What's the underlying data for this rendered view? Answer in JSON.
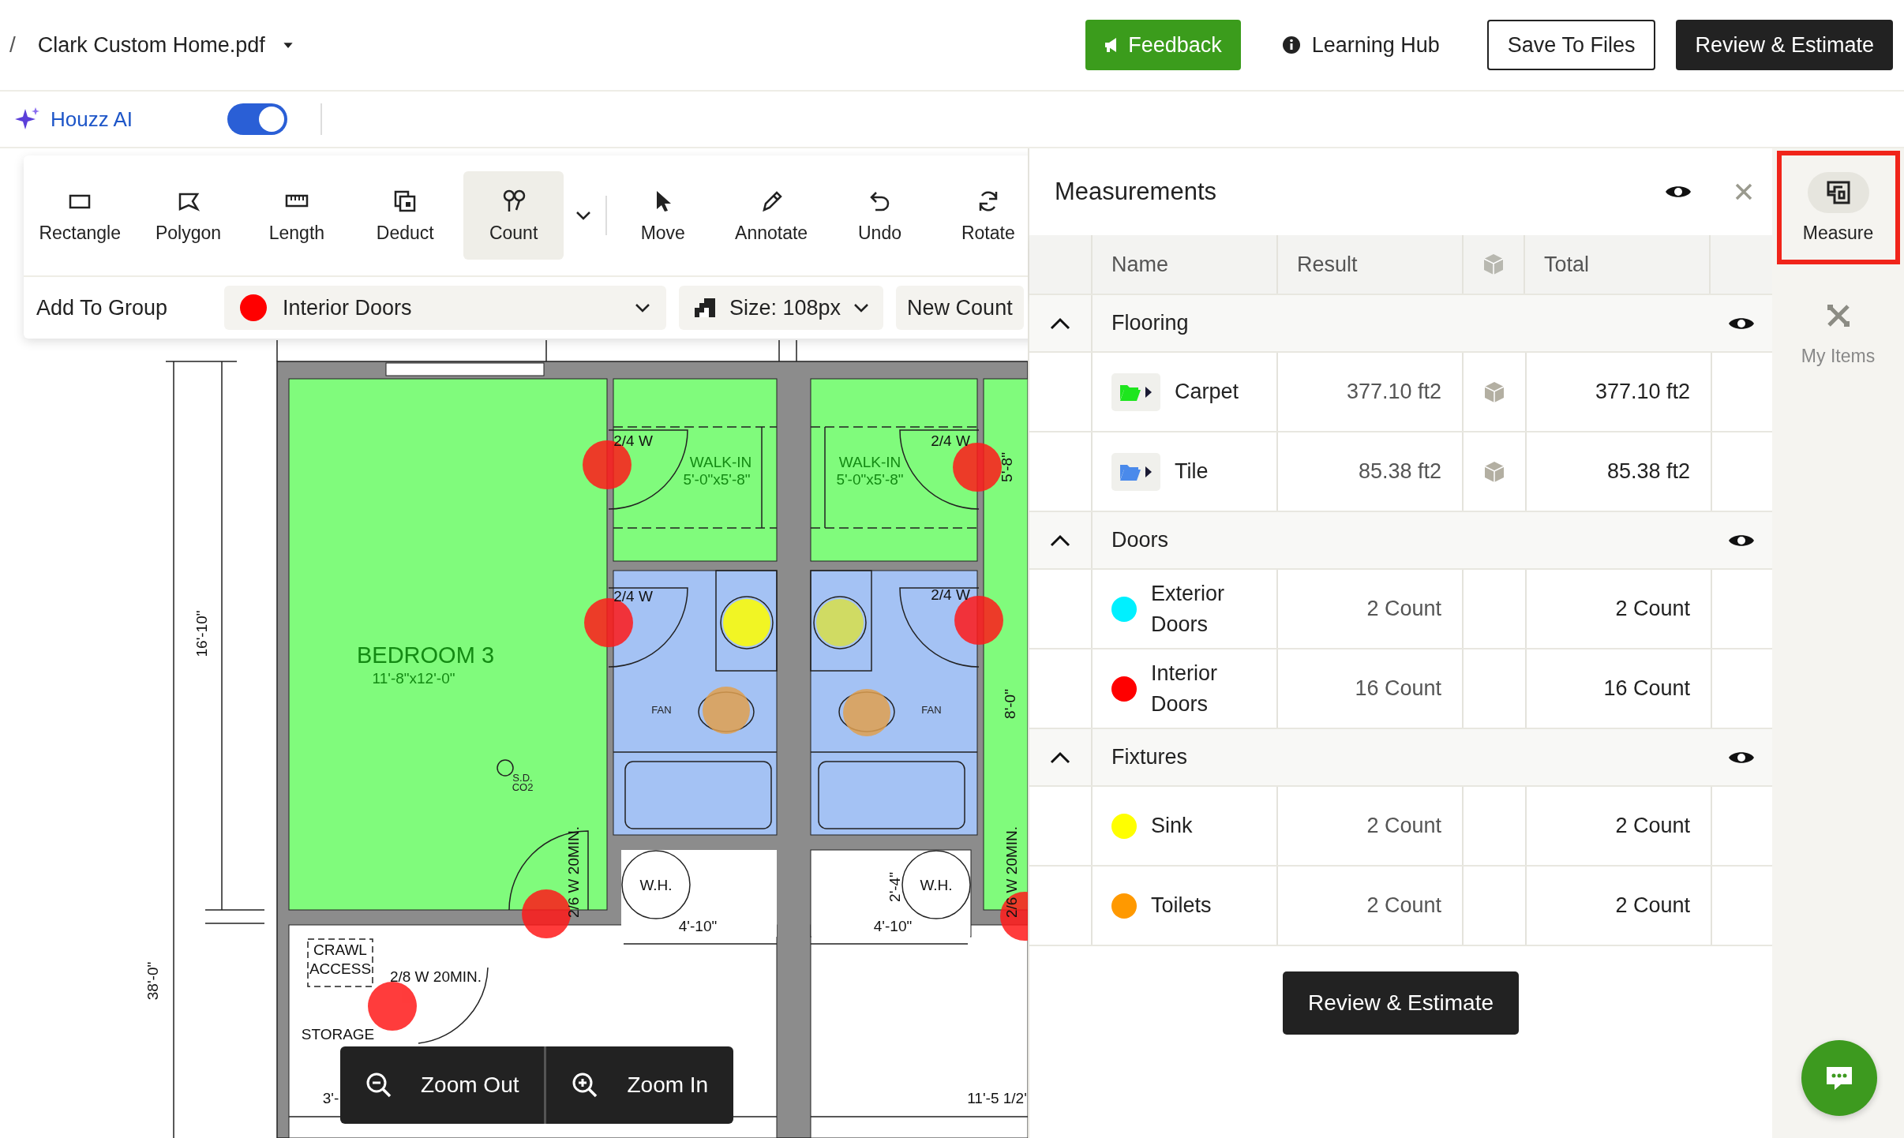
{
  "header": {
    "breadcrumb_separator": "/",
    "file_name": "Clark Custom Home.pdf",
    "buttons": [
      {
        "label": "Feedback",
        "kind": "feedback"
      },
      {
        "label": "Learning Hub",
        "kind": "link"
      },
      {
        "label": "Save To Files",
        "kind": "outline"
      },
      {
        "label": "Review & Estimate",
        "kind": "primary"
      }
    ]
  },
  "ai_bar": {
    "label": "Houzz AI",
    "on": true
  },
  "toolbar": {
    "tools": [
      {
        "label": "Rectangle",
        "selected": false,
        "has_menu": false
      },
      {
        "label": "Polygon",
        "selected": false,
        "has_menu": false
      },
      {
        "label": "Length",
        "selected": false,
        "has_menu": false
      },
      {
        "label": "Deduct",
        "selected": false,
        "has_menu": false
      },
      {
        "label": "Count",
        "selected": true,
        "has_menu": true
      },
      {
        "label": "Move",
        "selected": false,
        "has_menu": false
      },
      {
        "label": "Annotate",
        "selected": false,
        "has_menu": false
      },
      {
        "label": "Undo",
        "selected": false,
        "has_menu": false
      },
      {
        "label": "Rotate",
        "selected": false,
        "has_menu": false
      }
    ],
    "add_to_group": {
      "label": "Add To Group",
      "group": "Interior Doors",
      "color": "#ff0000"
    },
    "size": "Size: 108px",
    "new_count": "New Count"
  },
  "plan_labels": [
    {
      "text": "BEDROOM 3",
      "kind": "room"
    },
    {
      "text": "11'-8\"x12'-0\"",
      "kind": "roomsub"
    },
    {
      "text": "WALK-IN",
      "kind": "roomsub"
    },
    {
      "text": "5'-0\"x5'-8\"",
      "kind": "roomsub"
    },
    {
      "text": "WALK-IN",
      "kind": "roomsub"
    },
    {
      "text": "5'-0\"x5'-8\"",
      "kind": "roomsub"
    },
    {
      "text": "2/4 W",
      "kind": "note"
    },
    {
      "text": "2/4 W",
      "kind": "note"
    },
    {
      "text": "2/4 W",
      "kind": "note"
    },
    {
      "text": "2/4 W",
      "kind": "note"
    },
    {
      "text": "FAN",
      "kind": "small"
    },
    {
      "text": "FAN",
      "kind": "small"
    },
    {
      "text": "S.D.",
      "kind": "small"
    },
    {
      "text": "CO2",
      "kind": "small"
    },
    {
      "text": "16'-10\"",
      "kind": "vertical"
    },
    {
      "text": "38'-0\"",
      "kind": "vertical"
    },
    {
      "text": "5'-8\"",
      "kind": "vertical"
    },
    {
      "text": "8'-0\"",
      "kind": "vertical"
    },
    {
      "text": "2/6 W 20MIN.",
      "kind": "vertical"
    },
    {
      "text": "2/6 W 20MIN.",
      "kind": "vertical"
    },
    {
      "text": "2'-4\"",
      "kind": "vertical"
    },
    {
      "text": "W.H.",
      "kind": "note"
    },
    {
      "text": "W.H.",
      "kind": "note"
    },
    {
      "text": "4'-10\"",
      "kind": "note"
    },
    {
      "text": "4'-10\"",
      "kind": "note"
    },
    {
      "text": "CRAWL",
      "kind": "note"
    },
    {
      "text": "ACCESS",
      "kind": "note"
    },
    {
      "text": "2/8 W 20MIN.",
      "kind": "note"
    },
    {
      "text": "STORAGE",
      "kind": "note"
    },
    {
      "text": "3'-",
      "kind": "note"
    },
    {
      "text": "11'-5 1/2'",
      "kind": "note"
    }
  ],
  "zoom_controls": [
    {
      "label": "Zoom Out",
      "kind": "out"
    },
    {
      "label": "Zoom In",
      "kind": "in"
    }
  ],
  "measurements": {
    "title": "Measurements",
    "columns": [
      "Name",
      "Result",
      "Total"
    ],
    "groups": [
      {
        "name": "Flooring",
        "expanded": true,
        "items": [
          {
            "name": "Carpet",
            "kind": "folder",
            "color": "#1ee61e",
            "result": "377.10 ft2",
            "total": "377.10 ft2"
          },
          {
            "name": "Tile",
            "kind": "folder",
            "color": "#4a8aeb",
            "result": "85.38 ft2",
            "total": "85.38 ft2"
          }
        ]
      },
      {
        "name": "Doors",
        "expanded": true,
        "items": [
          {
            "name": "Exterior Doors",
            "kind": "dot",
            "color": "#00f0ff",
            "result": "2 Count",
            "total": "2 Count"
          },
          {
            "name": "Interior Doors",
            "kind": "dot",
            "color": "#ff0000",
            "result": "16 Count",
            "total": "16 Count"
          }
        ]
      },
      {
        "name": "Fixtures",
        "expanded": true,
        "items": [
          {
            "name": "Sink",
            "kind": "dot",
            "color": "#ffff00",
            "result": "2 Count",
            "total": "2 Count"
          },
          {
            "name": "Toilets",
            "kind": "dot",
            "color": "#ff9900",
            "result": "2 Count",
            "total": "2 Count"
          }
        ]
      }
    ],
    "button": "Review & Estimate"
  },
  "rail": [
    {
      "label": "Measure",
      "selected": true
    },
    {
      "label": "My Items",
      "selected": false
    }
  ]
}
